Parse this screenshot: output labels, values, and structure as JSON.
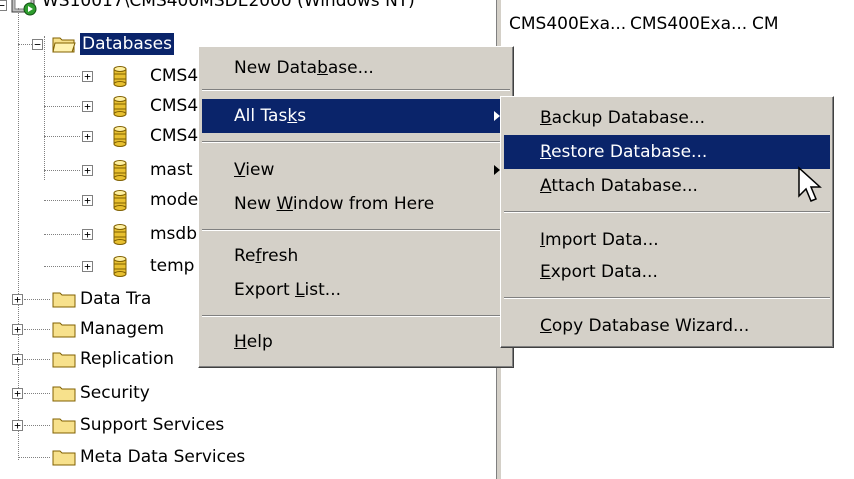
{
  "tree": {
    "root_label": "WS10017\\CMS400MSDE2000 (Windows NT)",
    "databases_label": "Databases",
    "db_items": [
      {
        "label": "CMS4"
      },
      {
        "label": "CMS4"
      },
      {
        "label": "CMS4"
      },
      {
        "label": "mast"
      },
      {
        "label": "mode"
      },
      {
        "label": "msdb"
      },
      {
        "label": "temp"
      }
    ],
    "folders": [
      {
        "label": "Data Tra"
      },
      {
        "label": "Managem"
      },
      {
        "label": "Replication"
      },
      {
        "label": "Security"
      },
      {
        "label": "Support Services"
      },
      {
        "label": "Meta Data Services"
      }
    ]
  },
  "list": {
    "headers": [
      "CMS400Exa...",
      "CMS400Exa...",
      "CM"
    ]
  },
  "context_menu": {
    "items": [
      {
        "pre": "New Data",
        "acc": "b",
        "post": "ase..."
      },
      {
        "pre": "All Tas",
        "acc": "k",
        "post": "s"
      },
      {
        "pre": "",
        "acc": "V",
        "post": "iew"
      },
      {
        "pre": "New ",
        "acc": "W",
        "post": "indow from Here"
      },
      {
        "pre": "Re",
        "acc": "f",
        "post": "resh"
      },
      {
        "pre": "Export ",
        "acc": "L",
        "post": "ist..."
      },
      {
        "pre": "",
        "acc": "H",
        "post": "elp"
      }
    ]
  },
  "submenu": {
    "items": [
      {
        "pre": "",
        "acc": "B",
        "post": "ackup Database..."
      },
      {
        "pre": "",
        "acc": "R",
        "post": "estore Database..."
      },
      {
        "pre": "",
        "acc": "A",
        "post": "ttach Database..."
      },
      {
        "pre": "",
        "acc": "I",
        "post": "mport Data..."
      },
      {
        "pre": "",
        "acc": "E",
        "post": "xport Data..."
      },
      {
        "pre": "",
        "acc": "C",
        "post": "opy Database Wizard..."
      }
    ]
  },
  "colors": {
    "highlight": "#0a246a",
    "menu_bg": "#d4d0c8",
    "folder_yellow": "#f7e18c",
    "db_yellow": "#e8c030",
    "server_green": "#2e9d2e"
  }
}
